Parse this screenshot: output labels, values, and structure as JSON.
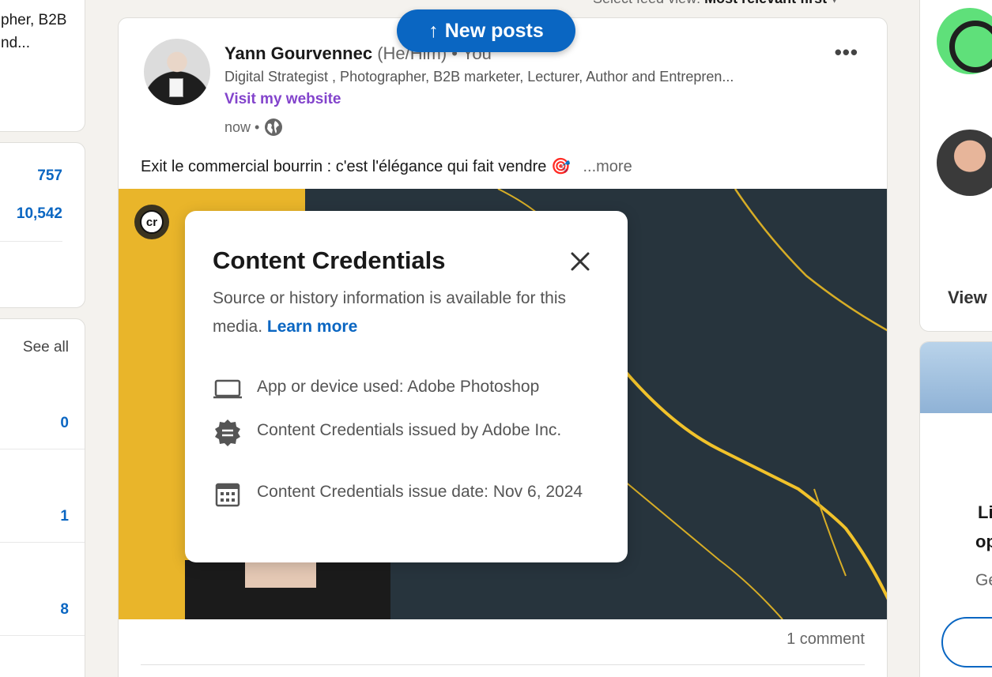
{
  "left": {
    "snippet_line1": "pher, B2B",
    "snippet_line2": "nd...",
    "stats": [
      "757",
      "10,542"
    ],
    "see_all": "See all",
    "list_values": [
      "0",
      "1",
      "8"
    ]
  },
  "feed": {
    "sort_label": "Select feed view:",
    "sort_value": "Most relevant first"
  },
  "new_posts_button": "New posts",
  "post": {
    "author_name": "Yann Gourvennec",
    "author_meta": "(He/Him) • You",
    "headline": "Digital Strategist , Photographer, B2B marketer, Lecturer, Author and Entrepren...",
    "website_link": "Visit my website",
    "time": "now •",
    "text": "Exit le commercial bourrin : c'est l'élégance qui fait vendre 🎯",
    "more": "...more",
    "cr_badge": "cr",
    "comment_count": "1 comment"
  },
  "popup": {
    "title": "Content Credentials",
    "description": "Source or history information is available for this media.",
    "learn_more": "Learn more",
    "items": [
      {
        "icon": "laptop-icon",
        "text": "App or device used: Adobe Photoshop"
      },
      {
        "icon": "badge-icon",
        "text": "Content Credentials issued by Adobe Inc."
      },
      {
        "icon": "calendar-icon",
        "text": "Content Credentials issue date: Nov 6, 2024"
      }
    ]
  },
  "right": {
    "view_label": "View",
    "promo_line1": "Li",
    "promo_line2": "op",
    "promo_line3": "Ge"
  },
  "colors": {
    "accent": "#0a66c2",
    "link_purple": "#8344cc",
    "background": "#f4f2ee"
  }
}
